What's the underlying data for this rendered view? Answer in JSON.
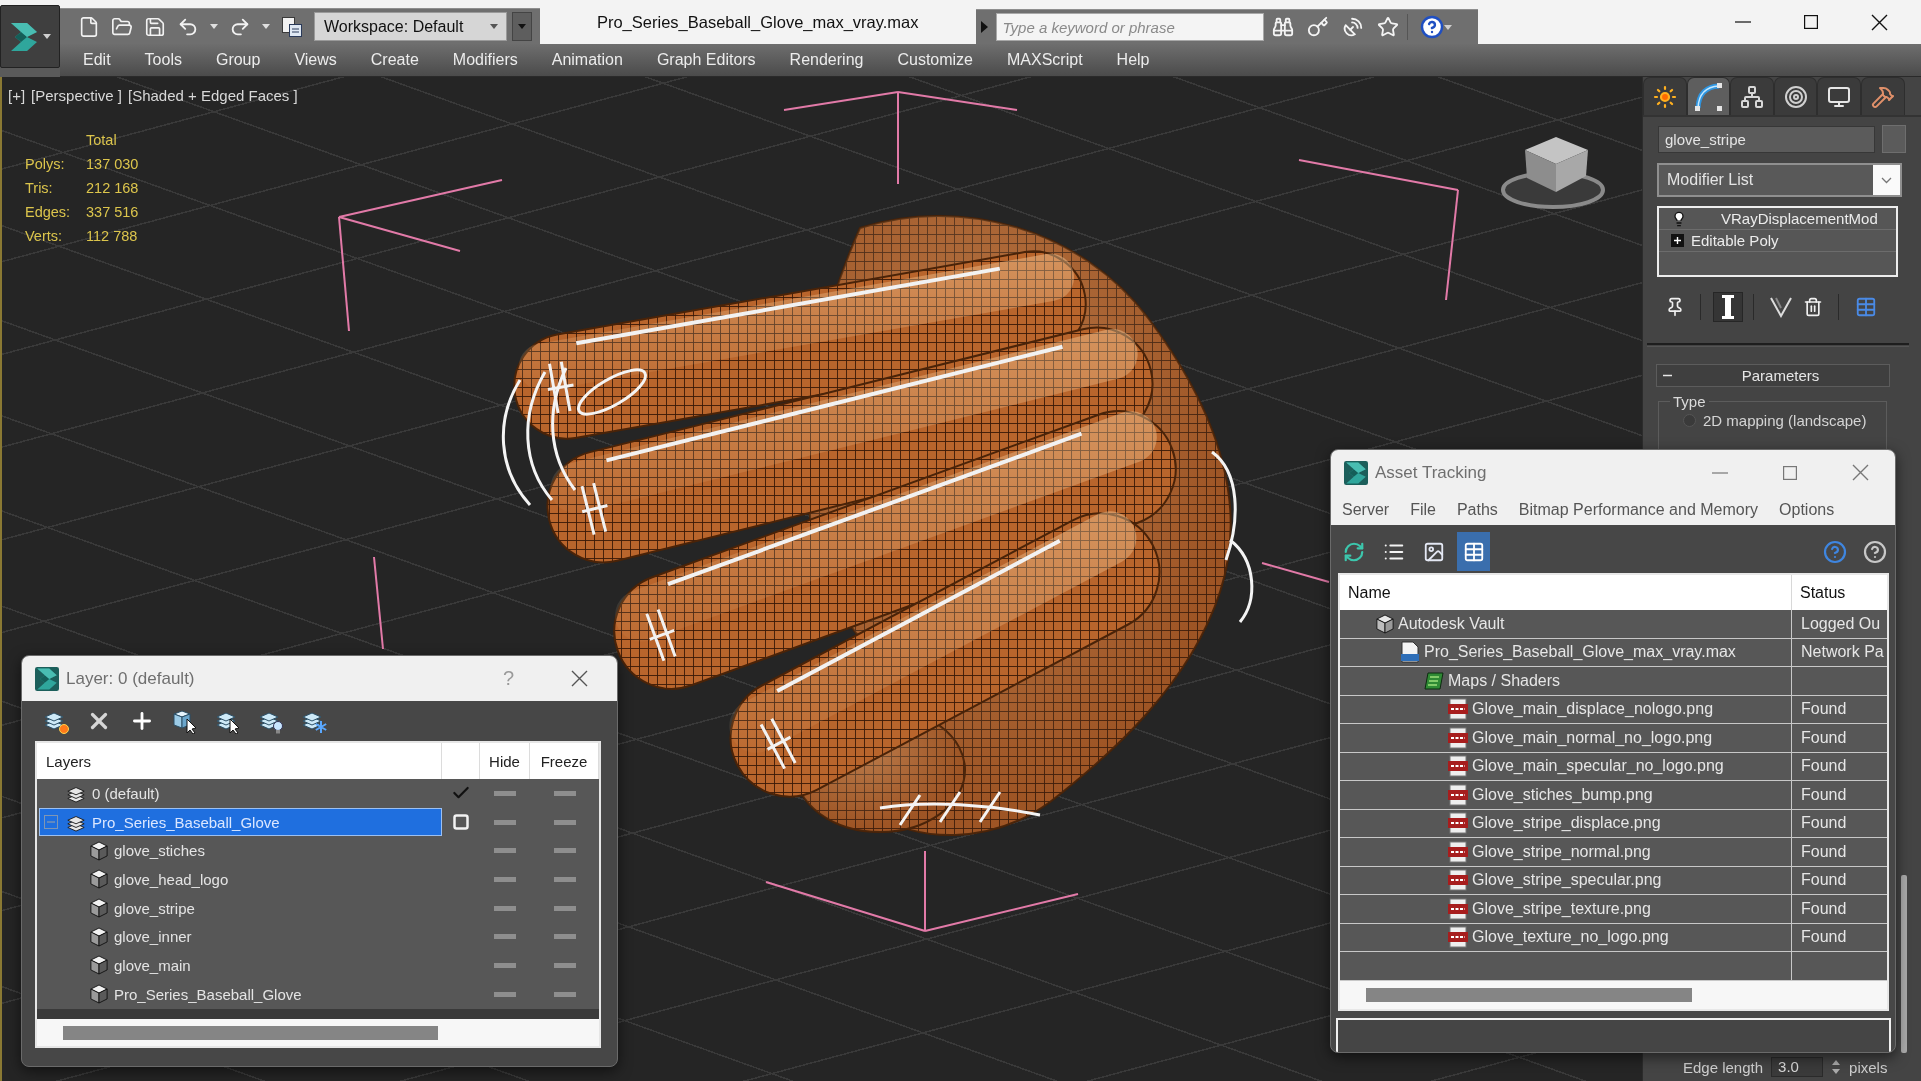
{
  "title_bar": {
    "title": "Pro_Series_Baseball_Glove_max_vray.max",
    "workspace": "Workspace: Default",
    "search": {
      "placeholder": "Type a keyword or phrase"
    }
  },
  "menu": [
    "Edit",
    "Tools",
    "Group",
    "Views",
    "Create",
    "Modifiers",
    "Animation",
    "Graph Editors",
    "Rendering",
    "Customize",
    "MAXScript",
    "Help"
  ],
  "viewport": {
    "labels": [
      "[+]",
      "[Perspective ]",
      "[Shaded + Edged Faces ]"
    ],
    "stats": {
      "heading": "Total",
      "rows": [
        {
          "label": "Polys:",
          "value": "137 030"
        },
        {
          "label": "Tris:",
          "value": "212 168"
        },
        {
          "label": "Edges:",
          "value": "337 516"
        },
        {
          "label": "Verts:",
          "value": "112 788"
        }
      ]
    }
  },
  "command_panel": {
    "tabs": [
      {
        "kind": "create",
        "selected": false
      },
      {
        "kind": "modify",
        "selected": true
      },
      {
        "kind": "hierarchy",
        "selected": false
      },
      {
        "kind": "motion",
        "selected": false
      },
      {
        "kind": "display",
        "selected": false
      },
      {
        "kind": "utilities",
        "selected": false
      }
    ],
    "object_name": "glove_stripe",
    "modifier_list": "Modifier List",
    "modifier_stack": [
      {
        "name": "VRayDisplacementMod",
        "kind": "modifier",
        "selected": false
      },
      {
        "name": "Editable Poly",
        "kind": "base_object",
        "selected": false
      }
    ],
    "stack_tools": [
      {
        "kind": "pin",
        "on": false
      },
      {
        "kind": "show_end_result",
        "on": true
      },
      {
        "kind": "make_unique",
        "on": false
      },
      {
        "kind": "remove_modifier",
        "on": false
      },
      {
        "kind": "configure",
        "on": false
      }
    ],
    "rollout": {
      "title": "Parameters",
      "expanded": true,
      "group": "Type",
      "options": [
        {
          "label": "2D mapping (landscape)",
          "selected": false
        }
      ]
    },
    "edge_length": {
      "label": "Edge length",
      "value": "3.0",
      "unit": "pixels"
    }
  },
  "layer_dialog": {
    "title": "Layer: 0 (default)",
    "help": "?",
    "columns": [
      "Layers",
      "Hide",
      "Freeze"
    ],
    "layers": [
      {
        "name": "0 (default)",
        "kind": "layer",
        "current": true,
        "selected": false,
        "hidden": false,
        "frozen": false
      },
      {
        "name": "Pro_Series_Baseball_Glove",
        "kind": "layer",
        "current": false,
        "selected": true,
        "hidden": false,
        "frozen": false,
        "expanded": true,
        "children": [
          {
            "name": "glove_stiches",
            "kind": "object",
            "selected": false,
            "hidden": false,
            "frozen": false
          },
          {
            "name": "glove_head_logo",
            "kind": "object",
            "selected": false,
            "hidden": false,
            "frozen": false
          },
          {
            "name": "glove_stripe",
            "kind": "object",
            "selected": false,
            "hidden": false,
            "frozen": false
          },
          {
            "name": "glove_inner",
            "kind": "object",
            "selected": false,
            "hidden": false,
            "frozen": false
          },
          {
            "name": "glove_main",
            "kind": "object",
            "selected": false,
            "hidden": false,
            "frozen": false
          },
          {
            "name": "Pro_Series_Baseball_Glove",
            "kind": "object",
            "selected": false,
            "hidden": false,
            "frozen": false
          }
        ]
      }
    ]
  },
  "asset_tracking": {
    "title": "Asset Tracking",
    "menu": [
      "Server",
      "File",
      "Paths",
      "Bitmap Performance and Memory",
      "Options"
    ],
    "view_buttons": [
      {
        "kind": "refresh",
        "selected": false
      },
      {
        "kind": "list",
        "selected": false
      },
      {
        "kind": "thumbnails",
        "selected": false
      },
      {
        "kind": "table",
        "selected": true
      }
    ],
    "columns": [
      "Name",
      "Status"
    ],
    "assets": [
      {
        "name": "Autodesk Vault",
        "kind": "vault",
        "status": "Logged Ou",
        "selected": false,
        "children": [
          {
            "name": "Pro_Series_Baseball_Glove_max_vray.max",
            "kind": "scene_file",
            "status": "Network Pa",
            "selected": false,
            "children": [
              {
                "name": "Maps / Shaders",
                "kind": "folder",
                "selected": false,
                "children": [
                  {
                    "name": "Glove_main_displace_nologo.png",
                    "kind": "image",
                    "status": "Found",
                    "selected": false
                  },
                  {
                    "name": "Glove_main_normal_no_logo.png",
                    "kind": "image",
                    "status": "Found",
                    "selected": false
                  },
                  {
                    "name": "Glove_main_specular_no_logo.png",
                    "kind": "image",
                    "status": "Found",
                    "selected": false
                  },
                  {
                    "name": "Glove_stiches_bump.png",
                    "kind": "image",
                    "status": "Found",
                    "selected": false
                  },
                  {
                    "name": "Glove_stripe_displace.png",
                    "kind": "image",
                    "status": "Found",
                    "selected": false
                  },
                  {
                    "name": "Glove_stripe_normal.png",
                    "kind": "image",
                    "status": "Found",
                    "selected": false
                  },
                  {
                    "name": "Glove_stripe_specular.png",
                    "kind": "image",
                    "status": "Found",
                    "selected": false
                  },
                  {
                    "name": "Glove_stripe_texture.png",
                    "kind": "image",
                    "status": "Found",
                    "selected": false
                  },
                  {
                    "name": "Glove_texture_no_logo.png",
                    "kind": "image",
                    "status": "Found",
                    "selected": false
                  }
                ]
              }
            ]
          }
        ]
      }
    ]
  }
}
